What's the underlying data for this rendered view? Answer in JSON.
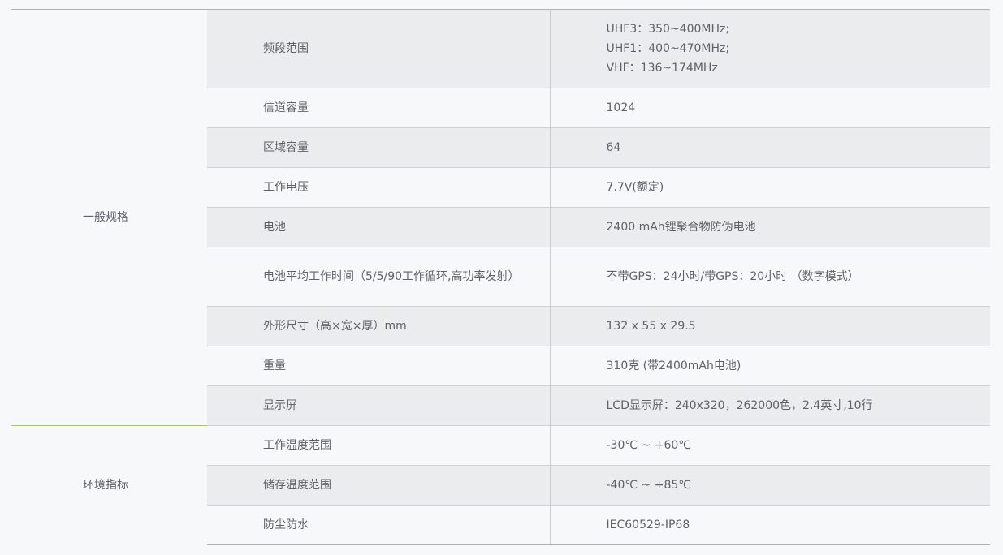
{
  "groups": [
    {
      "label": "一般规格",
      "rows": [
        {
          "param": "频段范围",
          "value": [
            "UHF3：350~400MHz;",
            "UHF1：400~470MHz;",
            "VHF：136~174MHz"
          ]
        },
        {
          "param": "信道容量",
          "value": [
            "1024"
          ]
        },
        {
          "param": "区域容量",
          "value": [
            "64"
          ]
        },
        {
          "param": "工作电压",
          "value": [
            "7.7V(额定)"
          ]
        },
        {
          "param": "电池",
          "value": [
            "2400 mAh锂聚合物防伪电池"
          ]
        },
        {
          "param": "电池平均工作时间（5/5/90工作循环,高功率发射）",
          "value": [
            "不带GPS：24小时/带GPS：20小时 （数字模式）"
          ]
        },
        {
          "param": "外形尺寸（高×宽×厚）mm",
          "value": [
            "132 x 55 x 29.5"
          ]
        },
        {
          "param": "重量",
          "value": [
            "310克 (带2400mAh电池)"
          ]
        },
        {
          "param": "显示屏",
          "value": [
            "LCD显示屏：240x320，262000色，2.4英寸,10行"
          ]
        }
      ]
    },
    {
      "label": "环境指标",
      "rows": [
        {
          "param": "工作温度范围",
          "value": [
            "-30℃ ~ +60℃"
          ]
        },
        {
          "param": "储存温度范围",
          "value": [
            "-40℃ ~ +85℃"
          ]
        },
        {
          "param": "防尘防水",
          "value": [
            "IEC60529-IP68"
          ]
        }
      ]
    }
  ]
}
